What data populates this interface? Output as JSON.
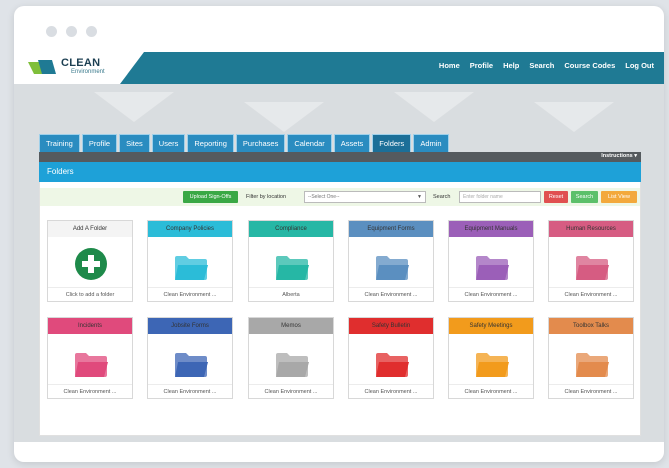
{
  "header": {
    "logo_text": "CLEAN",
    "logo_sub": "Environment",
    "nav": [
      "Home",
      "Profile",
      "Help",
      "Search",
      "Course Codes",
      "Log Out"
    ]
  },
  "tabs": [
    "Training",
    "Profile",
    "Sites",
    "Users",
    "Reporting",
    "Purchases",
    "Calendar",
    "Assets",
    "Folders",
    "Admin"
  ],
  "active_tab": "Folders",
  "instructions_label": "Instructions ▾",
  "section_title": "Folders",
  "toolbar": {
    "upload_label": "Upload Sign-Offs",
    "filter_label": "Filter by location",
    "filter_value": "--Select One--",
    "search_label": "Search",
    "search_placeholder": "Enter folder name",
    "reset_label": "Reset",
    "search_button": "Search",
    "list_view_label": "List View"
  },
  "add_folder": {
    "title": "Add A Folder",
    "footer": "Click to add a folder"
  },
  "folders": [
    {
      "name": "Company Policies",
      "footer": "Clean Environment ...",
      "color": "#2bbcd8"
    },
    {
      "name": "Compliance",
      "footer": "Alberta",
      "color": "#26b7a5"
    },
    {
      "name": "Equipment Forms",
      "footer": "Clean Environment ...",
      "color": "#5b8fc0"
    },
    {
      "name": "Equipment Manuals",
      "footer": "Clean Environment ...",
      "color": "#9b5fb8"
    },
    {
      "name": "Human Resources",
      "footer": "Clean Environment ...",
      "color": "#d65c82"
    },
    {
      "name": "Incidents",
      "footer": "Clean Environment ...",
      "color": "#e04a7c"
    },
    {
      "name": "Jobsite Forms",
      "footer": "Clean Environment ...",
      "color": "#3d66b5"
    },
    {
      "name": "Memos",
      "footer": "Clean Environment ...",
      "color": "#a8a8a8"
    },
    {
      "name": "Safety Bulletin",
      "footer": "Clean Environment ...",
      "color": "#e02e2e"
    },
    {
      "name": "Safety Meetings",
      "footer": "Clean Environment ...",
      "color": "#f29b1c"
    },
    {
      "name": "Toolbox Talks",
      "footer": "Clean Environment ...",
      "color": "#e38b4d"
    }
  ],
  "colors": {
    "header_blue": "#1f7a94",
    "tab_blue": "#2a8cc0",
    "folders_bar": "#1ea1d8",
    "add_green": "#1e8a4a",
    "upload_green": "#3aa845",
    "reset_red": "#e05050",
    "search_green": "#5cc06a",
    "list_orange": "#f3a93c"
  }
}
